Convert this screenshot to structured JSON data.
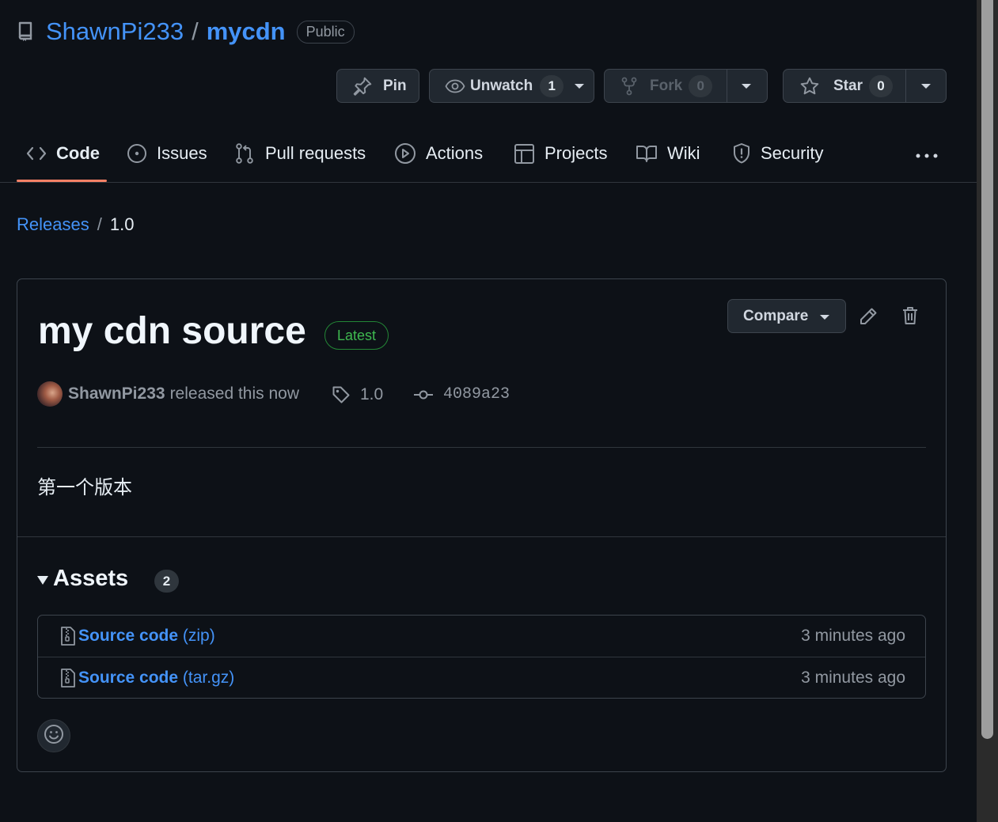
{
  "repo": {
    "owner": "ShawnPi233",
    "separator": "/",
    "name": "mycdn",
    "visibility": "Public"
  },
  "actions": {
    "pin_label": "Pin",
    "unwatch_label": "Unwatch",
    "watch_count": "1",
    "fork_label": "Fork",
    "fork_count": "0",
    "star_label": "Star",
    "star_count": "0"
  },
  "tabs": [
    {
      "label": "Code",
      "icon": "code-icon",
      "active": true
    },
    {
      "label": "Issues",
      "icon": "issue-icon"
    },
    {
      "label": "Pull requests",
      "icon": "pull-request-icon"
    },
    {
      "label": "Actions",
      "icon": "play-icon"
    },
    {
      "label": "Projects",
      "icon": "table-icon"
    },
    {
      "label": "Wiki",
      "icon": "book-icon"
    },
    {
      "label": "Security",
      "icon": "shield-icon"
    }
  ],
  "breadcrumb": {
    "parent": "Releases",
    "separator": "/",
    "current": "1.0"
  },
  "release": {
    "title": "my cdn source",
    "badge": "Latest",
    "compare_label": "Compare",
    "author": "ShawnPi233",
    "action_text": "released this now",
    "tag": "1.0",
    "commit": "4089a23",
    "notes": "第一个版本"
  },
  "assets": {
    "title": "Assets",
    "count": "2",
    "items": [
      {
        "name": "Source code",
        "ext": "(zip)",
        "time": "3 minutes ago"
      },
      {
        "name": "Source code",
        "ext": "(tar.gz)",
        "time": "3 minutes ago"
      }
    ]
  },
  "colors": {
    "background": "#0d1117",
    "link": "#4493f8",
    "latest_badge": "#3fb950",
    "active_tab_underline": "#f78166"
  }
}
